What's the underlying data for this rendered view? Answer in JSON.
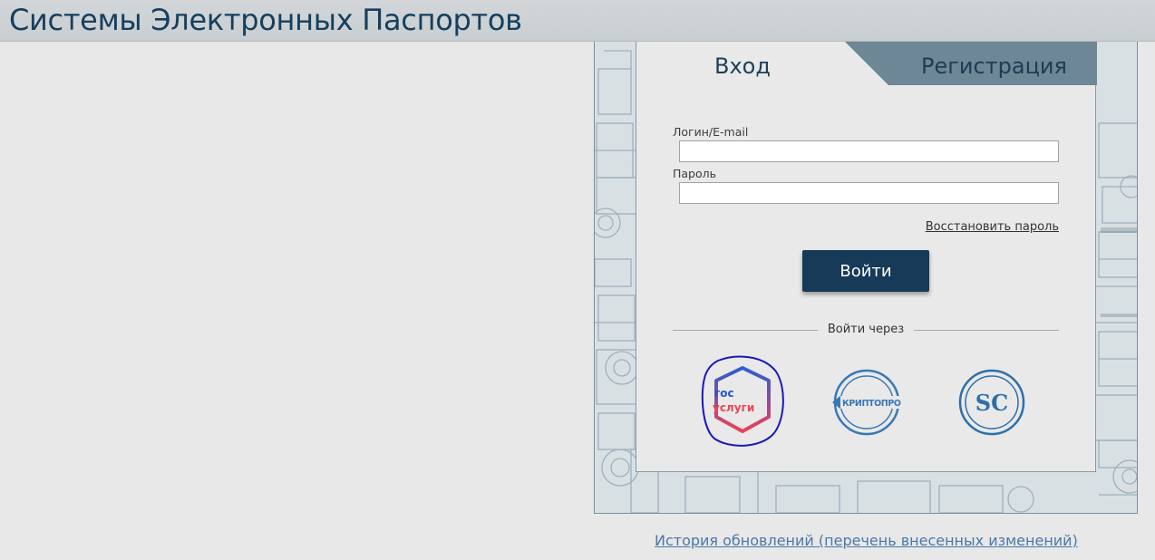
{
  "header": {
    "title": "Системы Электронных Паспортов"
  },
  "tabs": {
    "login": "Вход",
    "register": "Регистрация"
  },
  "form": {
    "login_label": "Логин/E-mail",
    "login_value": "",
    "password_label": "Пароль",
    "password_value": "",
    "restore_link": "Восстановить пароль",
    "submit_label": "Войти"
  },
  "alt_login": {
    "label": "Войти через",
    "providers": [
      {
        "icon": "gosuslugi-logo",
        "text_line1": "гос",
        "text_line2": "услуги"
      },
      {
        "icon": "cryptopro-logo",
        "text": "КРИПТОПРО"
      },
      {
        "icon": "sc-logo",
        "text": "SC"
      }
    ]
  },
  "footer": {
    "history_link": "История обновлений (перечень внесенных изменений)"
  },
  "colors": {
    "brand_dark": "#163a58",
    "title_color": "#163f5e",
    "tab_register_bg": "#6d8796",
    "link_color": "#4a78a8",
    "gosuslugi_blue": "#1f4ec0",
    "gosuslugi_red": "#e8475b",
    "cryptopro_blue": "#3a78b4",
    "sc_blue": "#2f6fa8"
  }
}
